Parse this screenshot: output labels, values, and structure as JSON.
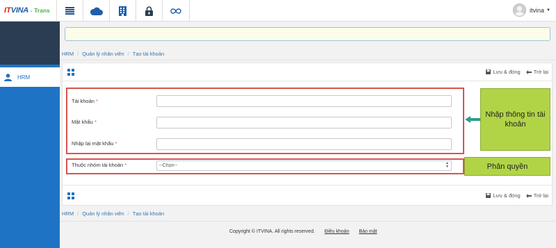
{
  "brand": {
    "logo_i": "IT",
    "logo_vina": "VINA",
    "logo_trans": "- Trans"
  },
  "nav": {
    "icons": [
      "list-icon",
      "cloud-icon",
      "building-icon",
      "lock-icon",
      "infinity-icon"
    ]
  },
  "user": {
    "name": "itvina"
  },
  "sidebar": {
    "hrm_label": "HRM"
  },
  "breadcrumb": {
    "items": [
      "HRM",
      "Quản lý nhân viên",
      "Tạo tài khoản"
    ],
    "separator": "/"
  },
  "toolbar": {
    "save_close_label": "Lưu & đóng",
    "back_label": "Trở lại"
  },
  "form": {
    "account_label": "Tài khoản",
    "password_label": "Mật khẩu",
    "confirm_password_label": "Nhập lại mật khẩu",
    "group_label": "Thuộc nhóm tài khoản",
    "required_mark": "*",
    "account_value": "",
    "password_value": "",
    "confirm_password_value": "",
    "group_selected": "--Chọn--"
  },
  "callouts": {
    "info_text": "Nhập thông tin tài khoản",
    "permission_text": "Phân quyền",
    "color": "#b1d447",
    "arrow_color": "#2a9d8f"
  },
  "footer": {
    "copyright": "Copyright © ITVINA. All rights reserved.",
    "terms": "Điều khoản",
    "privacy": "Bảo mật"
  },
  "colors": {
    "sidebar": "#1f73c5",
    "sidebar_top": "#2a3d52",
    "highlight_border": "#d9534f",
    "link": "#3276b1"
  }
}
